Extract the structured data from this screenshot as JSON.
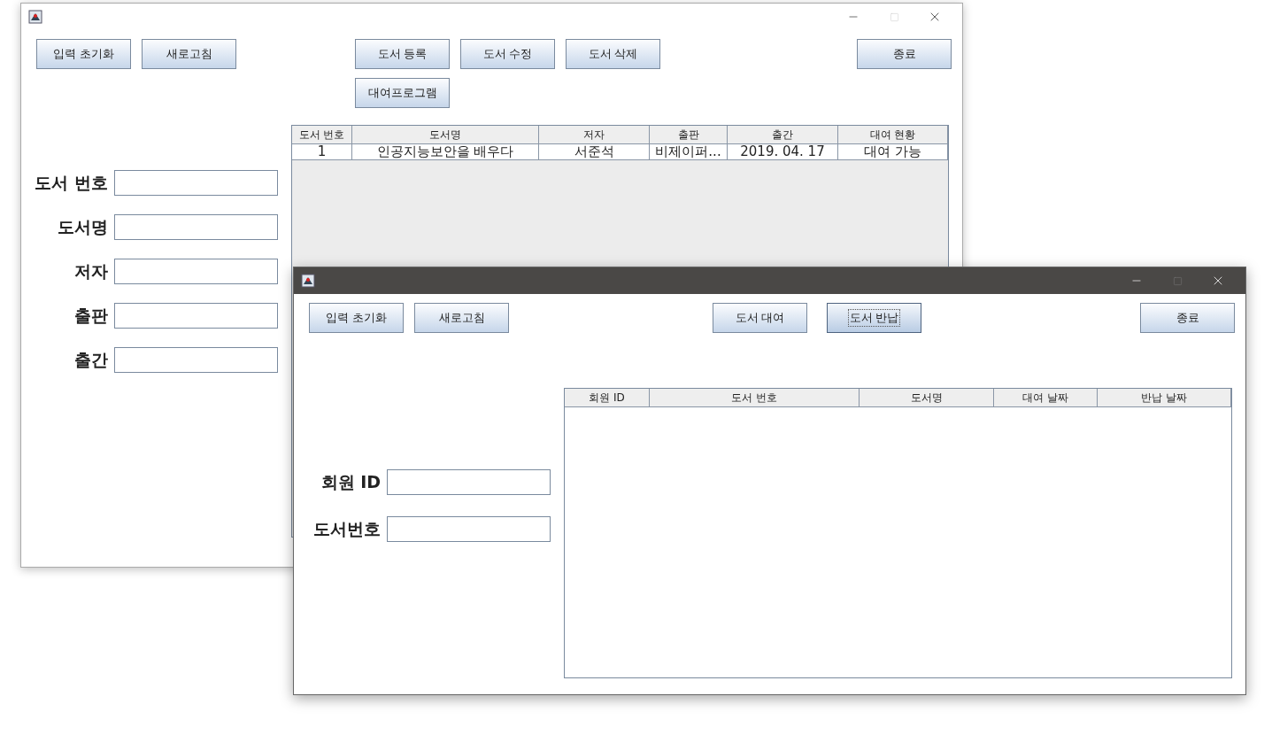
{
  "book_window": {
    "active": false,
    "toolbar": {
      "left": [
        {
          "label": "입력 초기화",
          "focused": false
        },
        {
          "label": "새로고침",
          "focused": false
        }
      ],
      "center": [
        {
          "label": "도서 등록",
          "focused": false
        },
        {
          "label": "도서 수정",
          "focused": false
        },
        {
          "label": "도서 삭제",
          "focused": false
        },
        {
          "label": "대여프로그램",
          "focused": false
        }
      ],
      "right": [
        {
          "label": "종료",
          "focused": false
        }
      ]
    },
    "form": [
      {
        "label": "도서 번호"
      },
      {
        "label": "도서명"
      },
      {
        "label": "저자"
      },
      {
        "label": "출판"
      },
      {
        "label": "출간"
      }
    ],
    "table": {
      "columns": [
        "도서 번호",
        "도서명",
        "저자",
        "출판",
        "출간",
        "대여 현황"
      ],
      "rows": [
        [
          "1",
          "인공지능보안을 배우다",
          "서준석",
          "비제이퍼...",
          "2019. 04. 17",
          "대여 가능"
        ]
      ]
    }
  },
  "rental_window": {
    "active": true,
    "toolbar": {
      "left": [
        {
          "label": "입력 초기화",
          "focused": false
        },
        {
          "label": "새로고침",
          "focused": false
        }
      ],
      "center": [
        {
          "label": "도서 대여",
          "focused": false
        },
        {
          "label": "도서 반납",
          "focused": true
        }
      ],
      "right": [
        {
          "label": "종료",
          "focused": false
        }
      ]
    },
    "form": [
      {
        "label": "회원 ID"
      },
      {
        "label": "도서번호"
      }
    ],
    "table": {
      "columns": [
        "회원 ID",
        "도서 번호",
        "도서명",
        "대여 날짜",
        "반납 날짜"
      ]
    }
  }
}
